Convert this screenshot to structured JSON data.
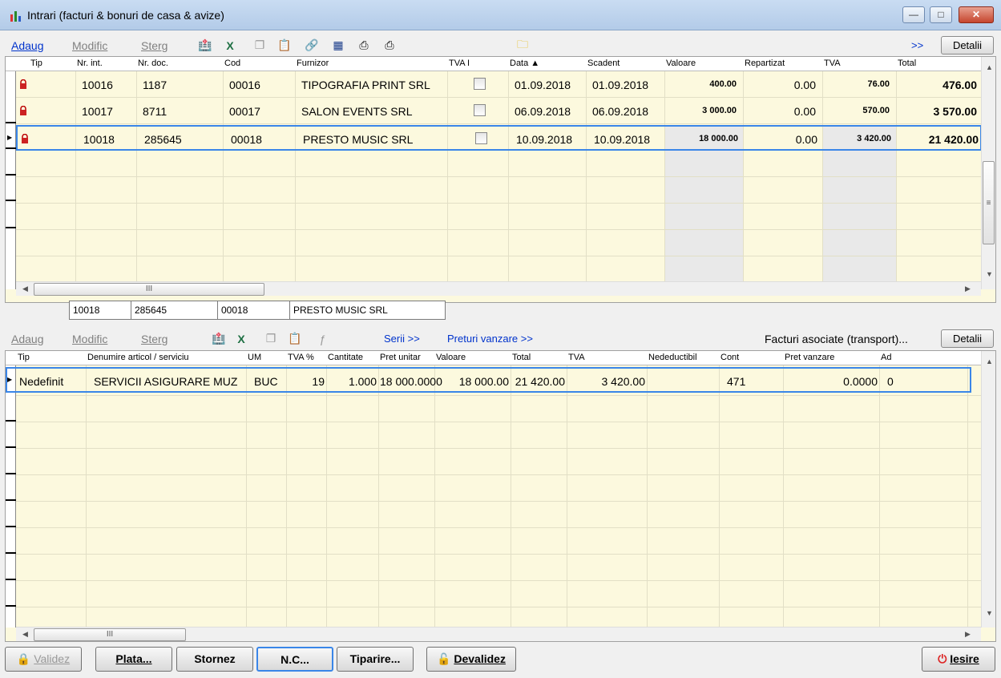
{
  "window": {
    "title": "Intrari (facturi & bonuri de casa & avize)"
  },
  "toolbar1": {
    "add": "Adaug",
    "modify": "Modific",
    "delete": "Sterg",
    "more": ">>",
    "details": "Detalii"
  },
  "grid1": {
    "headers": [
      "Tip",
      "Nr. int.",
      "Nr. doc.",
      "Cod",
      "Furnizor",
      "TVA I",
      "Data ▲",
      "Scadent",
      "Valoare",
      "Repartizat",
      "TVA",
      "Total"
    ],
    "rows": [
      {
        "nr_int": "10016",
        "nr_doc": "1187",
        "cod": "00016",
        "furnizor": "TIPOGRAFIA PRINT SRL",
        "data": "01.09.2018",
        "scadent": "01.09.2018",
        "valoare": "400.00",
        "repartizat": "0.00",
        "tva": "76.00",
        "total": "476.00"
      },
      {
        "nr_int": "10017",
        "nr_doc": "8711",
        "cod": "00017",
        "furnizor": "SALON EVENTS SRL",
        "data": "06.09.2018",
        "scadent": "06.09.2018",
        "valoare": "3 000.00",
        "repartizat": "0.00",
        "tva": "570.00",
        "total": "3 570.00"
      },
      {
        "nr_int": "10018",
        "nr_doc": "285645",
        "cod": "00018",
        "furnizor": "PRESTO MUSIC SRL",
        "data": "10.09.2018",
        "scadent": "10.09.2018",
        "valoare": "18 000.00",
        "repartizat": "0.00",
        "tva": "3 420.00",
        "total": "21 420.00"
      }
    ]
  },
  "selected_info": {
    "nr_int": "10018",
    "nr_doc": "285645",
    "cod": "00018",
    "furnizor": "PRESTO MUSIC SRL"
  },
  "toolbar2": {
    "add": "Adaug",
    "modify": "Modific",
    "delete": "Sterg",
    "serii": "Serii >>",
    "preturi": "Preturi vanzare >>",
    "facturi_asociate": "Facturi asociate (transport)...",
    "details": "Detalii"
  },
  "grid2": {
    "headers": [
      "Tip",
      "Denumire articol / serviciu",
      "UM",
      "TVA %",
      "Cantitate",
      "Pret unitar",
      "Valoare",
      "Total",
      "TVA",
      "Nedeductibil",
      "Cont",
      "Pret vanzare",
      "Ad"
    ],
    "rows": [
      {
        "tip": "Nedefinit",
        "denumire": "SERVICII ASIGURARE MUZ",
        "um": "BUC",
        "tva_pct": "19",
        "cantitate": "1.000",
        "pret_unitar": "18 000.0000",
        "valoare": "18 000.00",
        "total": "21 420.00",
        "tva": "3 420.00",
        "nedeductibil": "",
        "cont": "471",
        "pret_vanzare": "0.0000",
        "ad": "0"
      }
    ]
  },
  "buttons": {
    "validez": "Validez",
    "plata": "Plata...",
    "stornez": "Stornez",
    "nc": "N.C...",
    "tiparire": "Tiparire...",
    "devalidez": "Devalidez",
    "iesire": "Iesire"
  },
  "scroll_glyph": "III"
}
